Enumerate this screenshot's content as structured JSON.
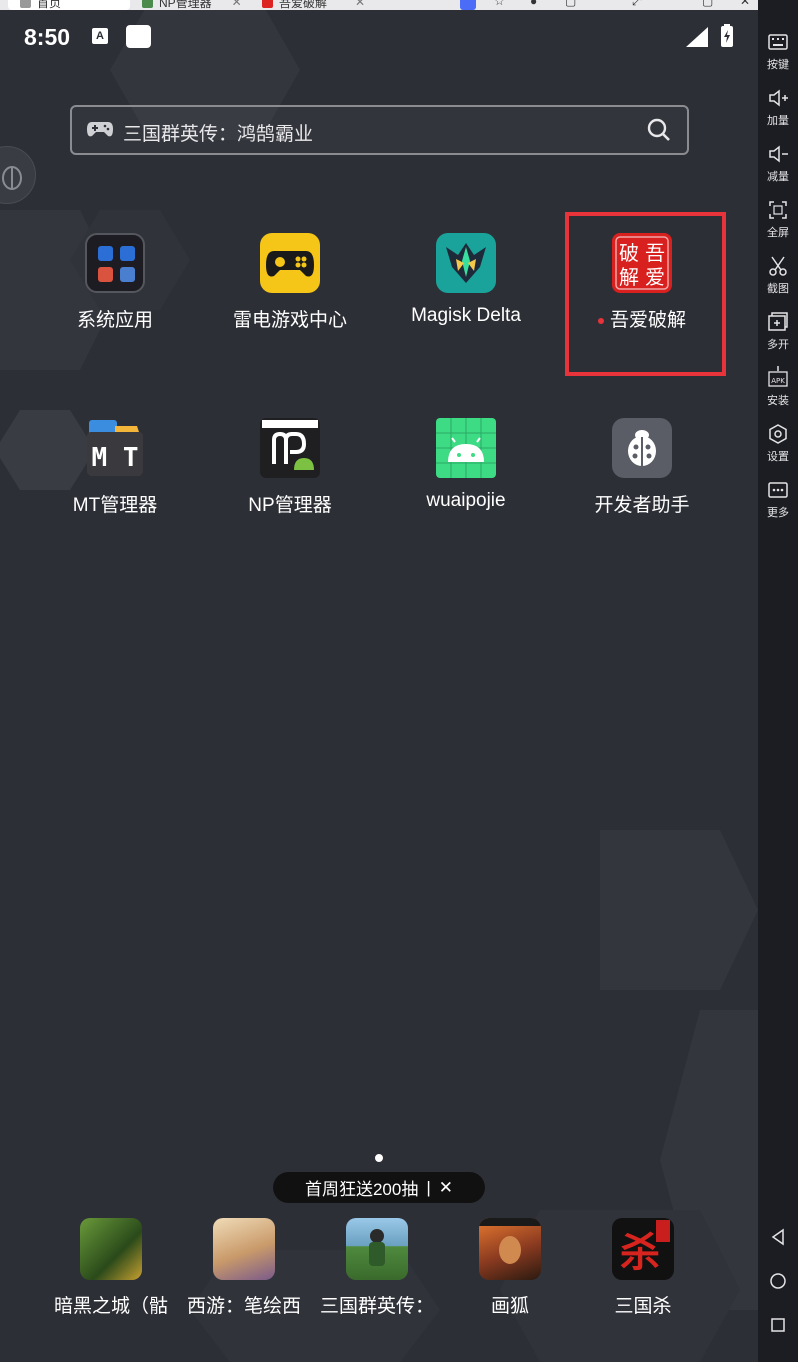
{
  "browser_tabs": [
    {
      "label": "首页",
      "active": true
    },
    {
      "label": "NP管理器",
      "active": false
    },
    {
      "label": "吾爱破解",
      "active": false
    }
  ],
  "status_bar": {
    "time": "8:50",
    "keyboard_badge": "A"
  },
  "search": {
    "text": "三国群英传：鸿鹄霸业"
  },
  "apps": [
    {
      "label": "系统应用",
      "icon": "folder-icon"
    },
    {
      "label": "雷电游戏中心",
      "icon": "gamepad-icon"
    },
    {
      "label": "Magisk Delta",
      "icon": "magisk-icon"
    },
    {
      "label": "吾爱破解",
      "icon": "52pojie-icon",
      "new_dot": true,
      "highlighted": true,
      "icon_text": [
        "破",
        "吾",
        "解",
        "爱"
      ]
    },
    {
      "label": "MT管理器",
      "icon": "mt-manager-icon",
      "icon_text": "M T"
    },
    {
      "label": "NP管理器",
      "icon": "np-manager-icon"
    },
    {
      "label": "wuaipojie",
      "icon": "android-icon"
    },
    {
      "label": "开发者助手",
      "icon": "ladybug-icon"
    }
  ],
  "promo": {
    "text": "首周狂送200抽",
    "separator": "|",
    "close": "✕"
  },
  "dock": [
    {
      "label": "暗黑之城（骷",
      "icon": "game-dark-city-icon",
      "color": "#3a6a2c"
    },
    {
      "label": "西游：笔绘西",
      "icon": "game-xiyou-icon",
      "color": "#d9b98c"
    },
    {
      "label": "三国群英传：",
      "icon": "game-sanguo-icon",
      "color": "#4f8a3e"
    },
    {
      "label": "画狐",
      "icon": "game-huahu-icon",
      "color": "#8a3a20"
    },
    {
      "label": "三国杀",
      "icon": "game-sanguosha-icon",
      "color": "#1a1a1a",
      "icon_text": "杀"
    }
  ],
  "sidebar": [
    {
      "label": "按键",
      "icon": "keyboard-icon"
    },
    {
      "label": "加量",
      "icon": "volume-up-icon"
    },
    {
      "label": "减量",
      "icon": "volume-down-icon"
    },
    {
      "label": "全屏",
      "icon": "fullscreen-icon"
    },
    {
      "label": "截图",
      "icon": "scissors-icon"
    },
    {
      "label": "多开",
      "icon": "multi-instance-icon"
    },
    {
      "label": "安装",
      "icon": "apk-install-icon",
      "icon_text": "APK"
    },
    {
      "label": "设置",
      "icon": "settings-icon"
    },
    {
      "label": "更多",
      "icon": "more-icon"
    }
  ],
  "nav": [
    "back-icon",
    "home-icon",
    "recents-icon"
  ],
  "colors": {
    "background": "#2d2f36",
    "highlight": "#e8333a",
    "sidebar": "#1c1d22"
  }
}
